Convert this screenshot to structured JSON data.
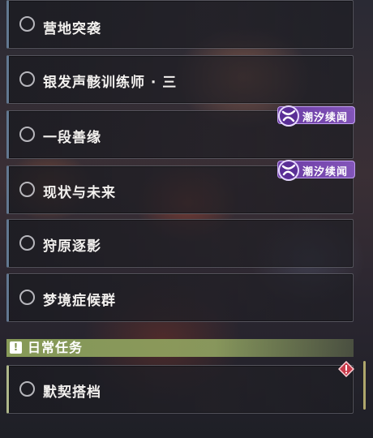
{
  "quests": [
    {
      "title": "营地突袭"
    },
    {
      "title": "银发声骸训练师 · 三"
    },
    {
      "title": "一段善缘",
      "tag": "潮汐续闻"
    },
    {
      "title": "现状与未来",
      "tag": "潮汐续闻"
    },
    {
      "title": "狩原逐影"
    },
    {
      "title": "梦境症候群"
    }
  ],
  "daily_section": {
    "label": "日常任务",
    "icon": "exclamation-icon",
    "quests": [
      {
        "title": "默契搭档",
        "badge": "red-alert-icon"
      }
    ]
  },
  "colors": {
    "tag_purple": "#7a4bb8",
    "section_green": "#8ca05a",
    "alert_red": "#c83a4a"
  }
}
